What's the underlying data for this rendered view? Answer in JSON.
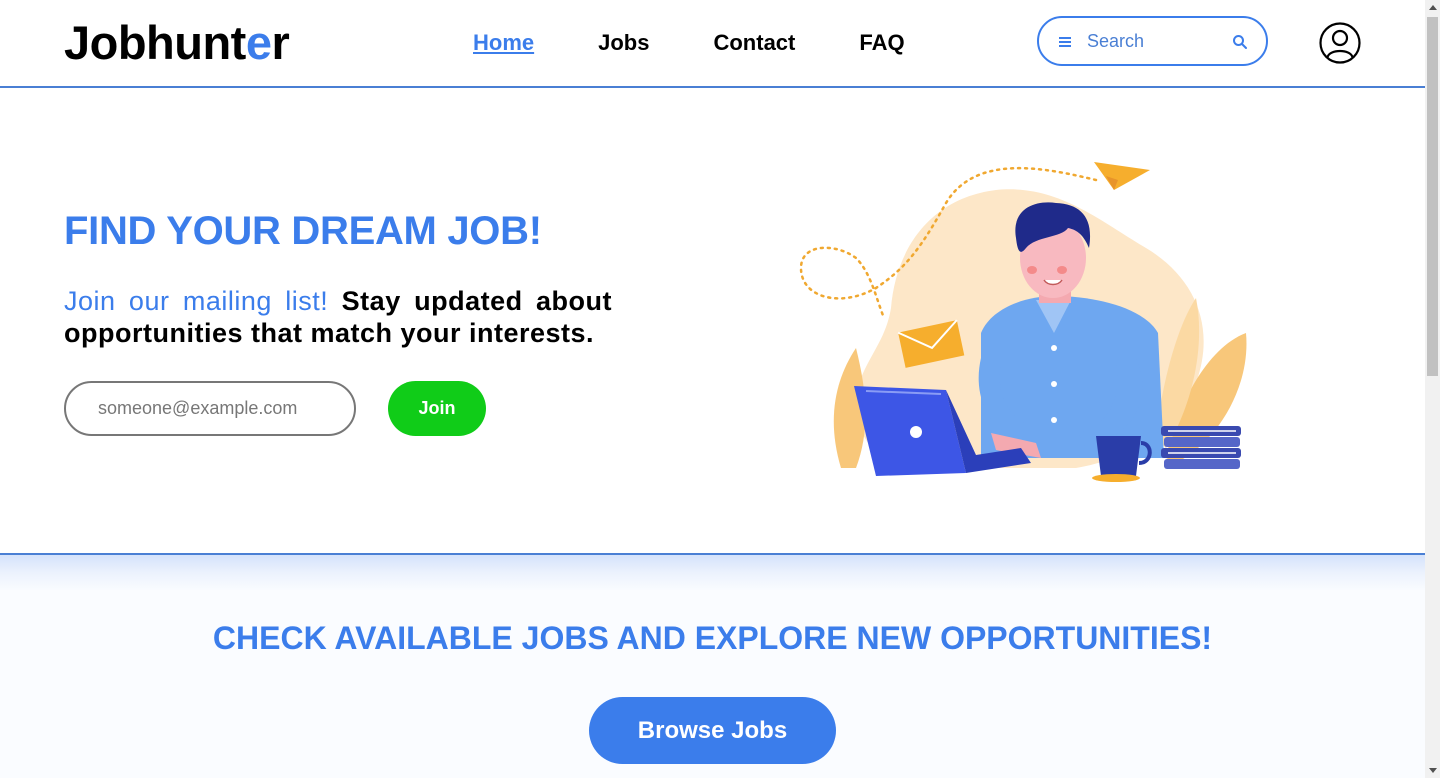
{
  "header": {
    "logo_main": "Jobhunt",
    "logo_accent": "e",
    "logo_end": "r",
    "nav": [
      {
        "label": "Home",
        "active": true
      },
      {
        "label": "Jobs",
        "active": false
      },
      {
        "label": "Contact",
        "active": false
      },
      {
        "label": "FAQ",
        "active": false
      }
    ],
    "search": {
      "placeholder": "Search"
    }
  },
  "hero": {
    "title": "FIND YOUR DREAM JOB!",
    "highlight": "Join our mailing list!",
    "text": " Stay updated about opportunities that match your interests.",
    "email_placeholder": "someone@example.com",
    "join_label": "Join"
  },
  "cta": {
    "title": "CHECK AVAILABLE JOBS AND EXPLORE NEW OPPORTUNITIES!",
    "button_label": "Browse Jobs"
  },
  "colors": {
    "accent": "#3b7deb",
    "join": "#10cc18",
    "border": "#4a7fd4"
  },
  "icons": {
    "search": "search-icon",
    "menu": "menu-icon",
    "profile": "user-circle-icon"
  }
}
